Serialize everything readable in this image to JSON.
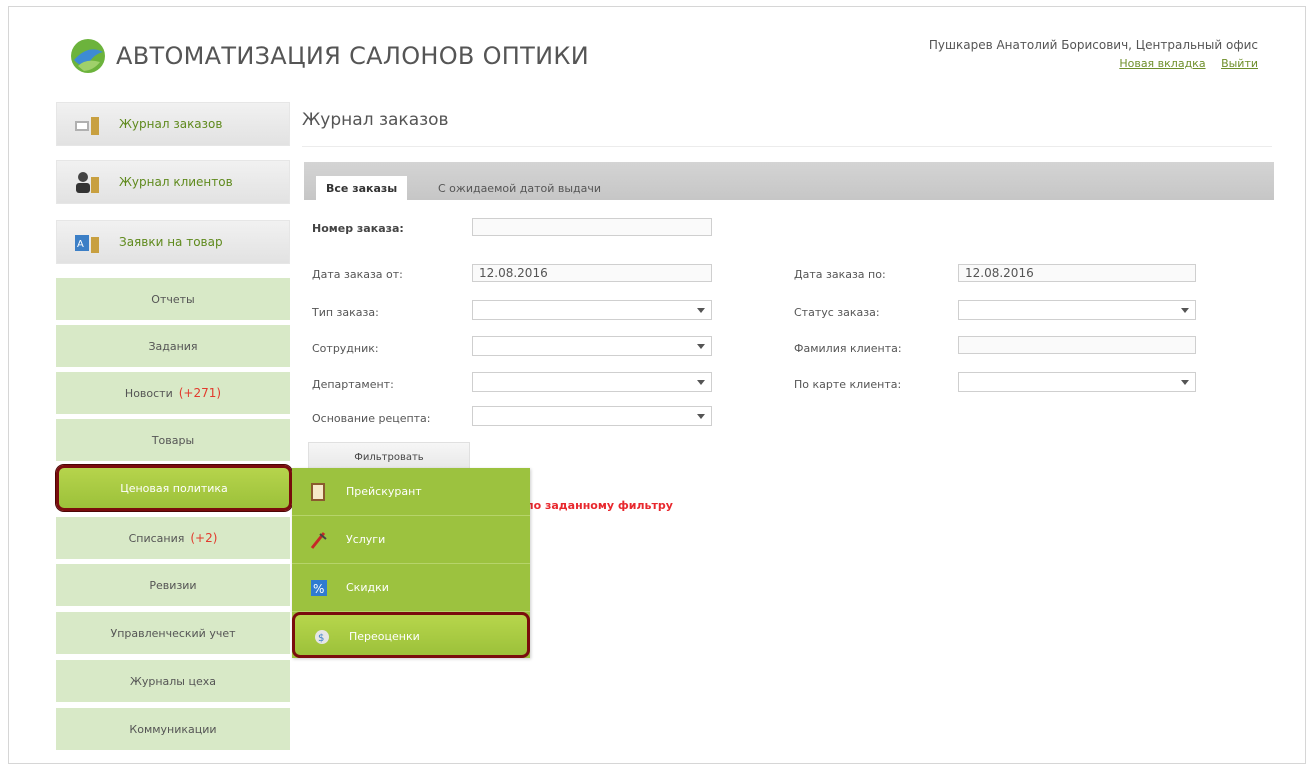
{
  "header": {
    "app_title": "АВТОМАТИЗАЦИЯ САЛОНОВ ОПТИКИ",
    "user": "Пушкарев Анатолий Борисович, Центральный офис",
    "new_tab_link": "Новая вкладка",
    "logout_link": "Выйти"
  },
  "sidebar": {
    "journals": [
      {
        "label": "Журнал заказов",
        "icon": "orders-journal-icon"
      },
      {
        "label": "Журнал клиентов",
        "icon": "clients-journal-icon"
      },
      {
        "label": "Заявки на товар",
        "icon": "product-requests-icon"
      }
    ],
    "items": [
      {
        "label": "Отчеты",
        "count": ""
      },
      {
        "label": "Задания",
        "count": ""
      },
      {
        "label": "Новости",
        "count": "(+271)"
      },
      {
        "label": "Товары",
        "count": ""
      },
      {
        "label": "Ценовая политика",
        "count": ""
      },
      {
        "label": "Списания",
        "count": "(+2)"
      },
      {
        "label": "Ревизии",
        "count": ""
      },
      {
        "label": "Управленческий учет",
        "count": ""
      },
      {
        "label": "Журналы цеха",
        "count": ""
      },
      {
        "label": "Коммуникации",
        "count": ""
      }
    ]
  },
  "main": {
    "title": "Журнал заказов",
    "tabs": [
      {
        "label": "Все заказы"
      },
      {
        "label": "С ожидаемой датой выдачи"
      }
    ],
    "filters": {
      "order_number_label": "Номер заказа:",
      "order_number_value": "",
      "date_from_label": "Дата заказа от:",
      "date_from_value": "12.08.2016",
      "date_to_label": "Дата заказа по:",
      "date_to_value": "12.08.2016",
      "order_type_label": "Тип заказа:",
      "order_status_label": "Статус заказа:",
      "employee_label": "Сотрудник:",
      "client_surname_label": "Фамилия клиента:",
      "department_label": "Департамент:",
      "client_card_label": "По карте клиента:",
      "prescription_label": "Основание рецепта:"
    },
    "filter_button": "Фильтровать",
    "no_results": "по заданному фильтру"
  },
  "submenu": {
    "items": [
      {
        "label": "Прейскурант",
        "icon": "price-list-icon"
      },
      {
        "label": "Услуги",
        "icon": "services-icon"
      },
      {
        "label": "Скидки",
        "icon": "discounts-icon"
      },
      {
        "label": "Переоценки",
        "icon": "revaluations-icon"
      }
    ]
  },
  "colors": {
    "accent_green": "#9cc23f",
    "light_green": "#d8e9c7",
    "highlight_border": "#7a0d0d",
    "link_green": "#6e8f2a",
    "count_red": "#e23a2d"
  }
}
